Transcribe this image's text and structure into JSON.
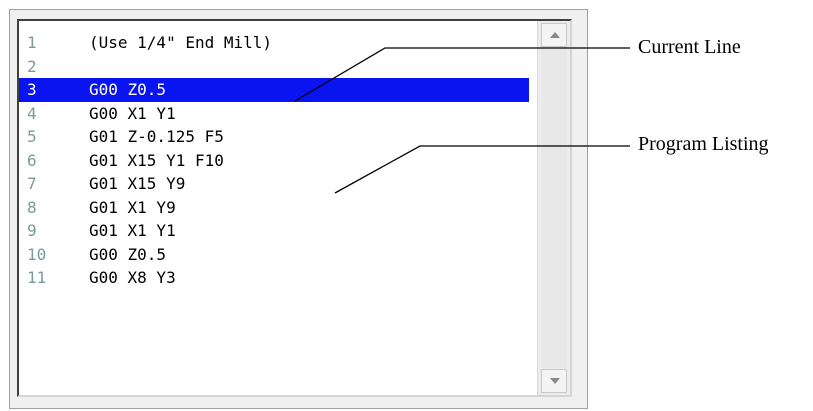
{
  "listing": {
    "current_line": 3,
    "lines": [
      {
        "num": "1",
        "code": "(Use 1/4\" End Mill)"
      },
      {
        "num": "2",
        "code": ""
      },
      {
        "num": "3",
        "code": "G00 Z0.5"
      },
      {
        "num": "4",
        "code": "G00 X1 Y1"
      },
      {
        "num": "5",
        "code": "G01 Z-0.125 F5"
      },
      {
        "num": "6",
        "code": "G01 X15 Y1 F10"
      },
      {
        "num": "7",
        "code": "G01 X15 Y9"
      },
      {
        "num": "8",
        "code": "G01 X1 Y9"
      },
      {
        "num": "9",
        "code": "G01 X1 Y1"
      },
      {
        "num": "10",
        "code": "G00 Z0.5"
      },
      {
        "num": "11",
        "code": "G00 X8 Y3"
      }
    ]
  },
  "annotations": {
    "current_line_label": "Current Line",
    "program_listing_label": "Program Listing"
  },
  "colors": {
    "highlight": "#0a14f0",
    "line_number": "#7a9a9a"
  },
  "icons": {
    "scroll_up": "scroll-up-arrow-icon",
    "scroll_down": "scroll-down-arrow-icon"
  }
}
